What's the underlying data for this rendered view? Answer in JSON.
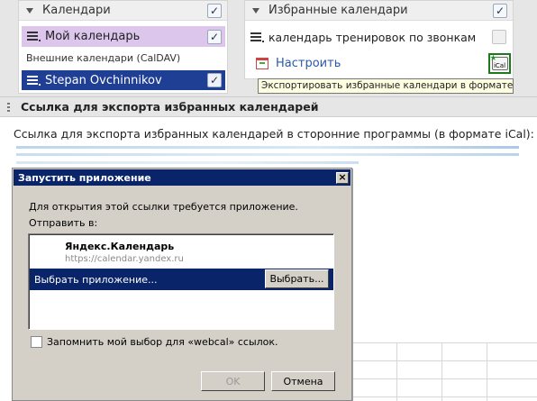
{
  "calendars_panel": {
    "title": "Календари",
    "my_calendar": "Мой календарь",
    "external_label": "Внешние календари (CalDAV)",
    "external_item": "Stepan Ovchinnikov"
  },
  "favorites_panel": {
    "title": "Избранные календари",
    "item": "календарь тренировок по звонкам",
    "configure_link": "Настроить",
    "ical_icon_label": "iCal"
  },
  "tooltip": "Экспортировать избранные календари в формате iCal",
  "export_panel": {
    "title": "Ссылка для экспорта избранных календарей",
    "description": "Ссылка для экспорта избранных календарей в сторонние программы (в формате iCal):"
  },
  "dialog": {
    "title": "Запустить приложение",
    "message": "Для открытия этой ссылки требуется приложение.",
    "send_to": "Отправить в:",
    "app_name": "Яндекс.Календарь",
    "app_url": "https://calendar.yandex.ru",
    "choose_label": "Выбрать приложение...",
    "choose_button": "Выбрать...",
    "remember_label": "Запомнить мой выбор для «webcal» ссылок.",
    "ok_button": "OK",
    "cancel_button": "Отмена"
  },
  "colors": {
    "my_calendar_bg": "#dcc6ec",
    "selected_bg": "#1f3f95",
    "dialog_title_bg": "#0a246a",
    "link": "#2a58a8",
    "ical_border": "#1c7a1c"
  },
  "icons": {
    "collapse": "triangle-down-icon",
    "calendar": "list-icon",
    "check": "checkmark-icon",
    "configure": "calendar-edit-icon",
    "export": "ical-icon",
    "grip": "grip-icon",
    "close": "close-icon"
  }
}
